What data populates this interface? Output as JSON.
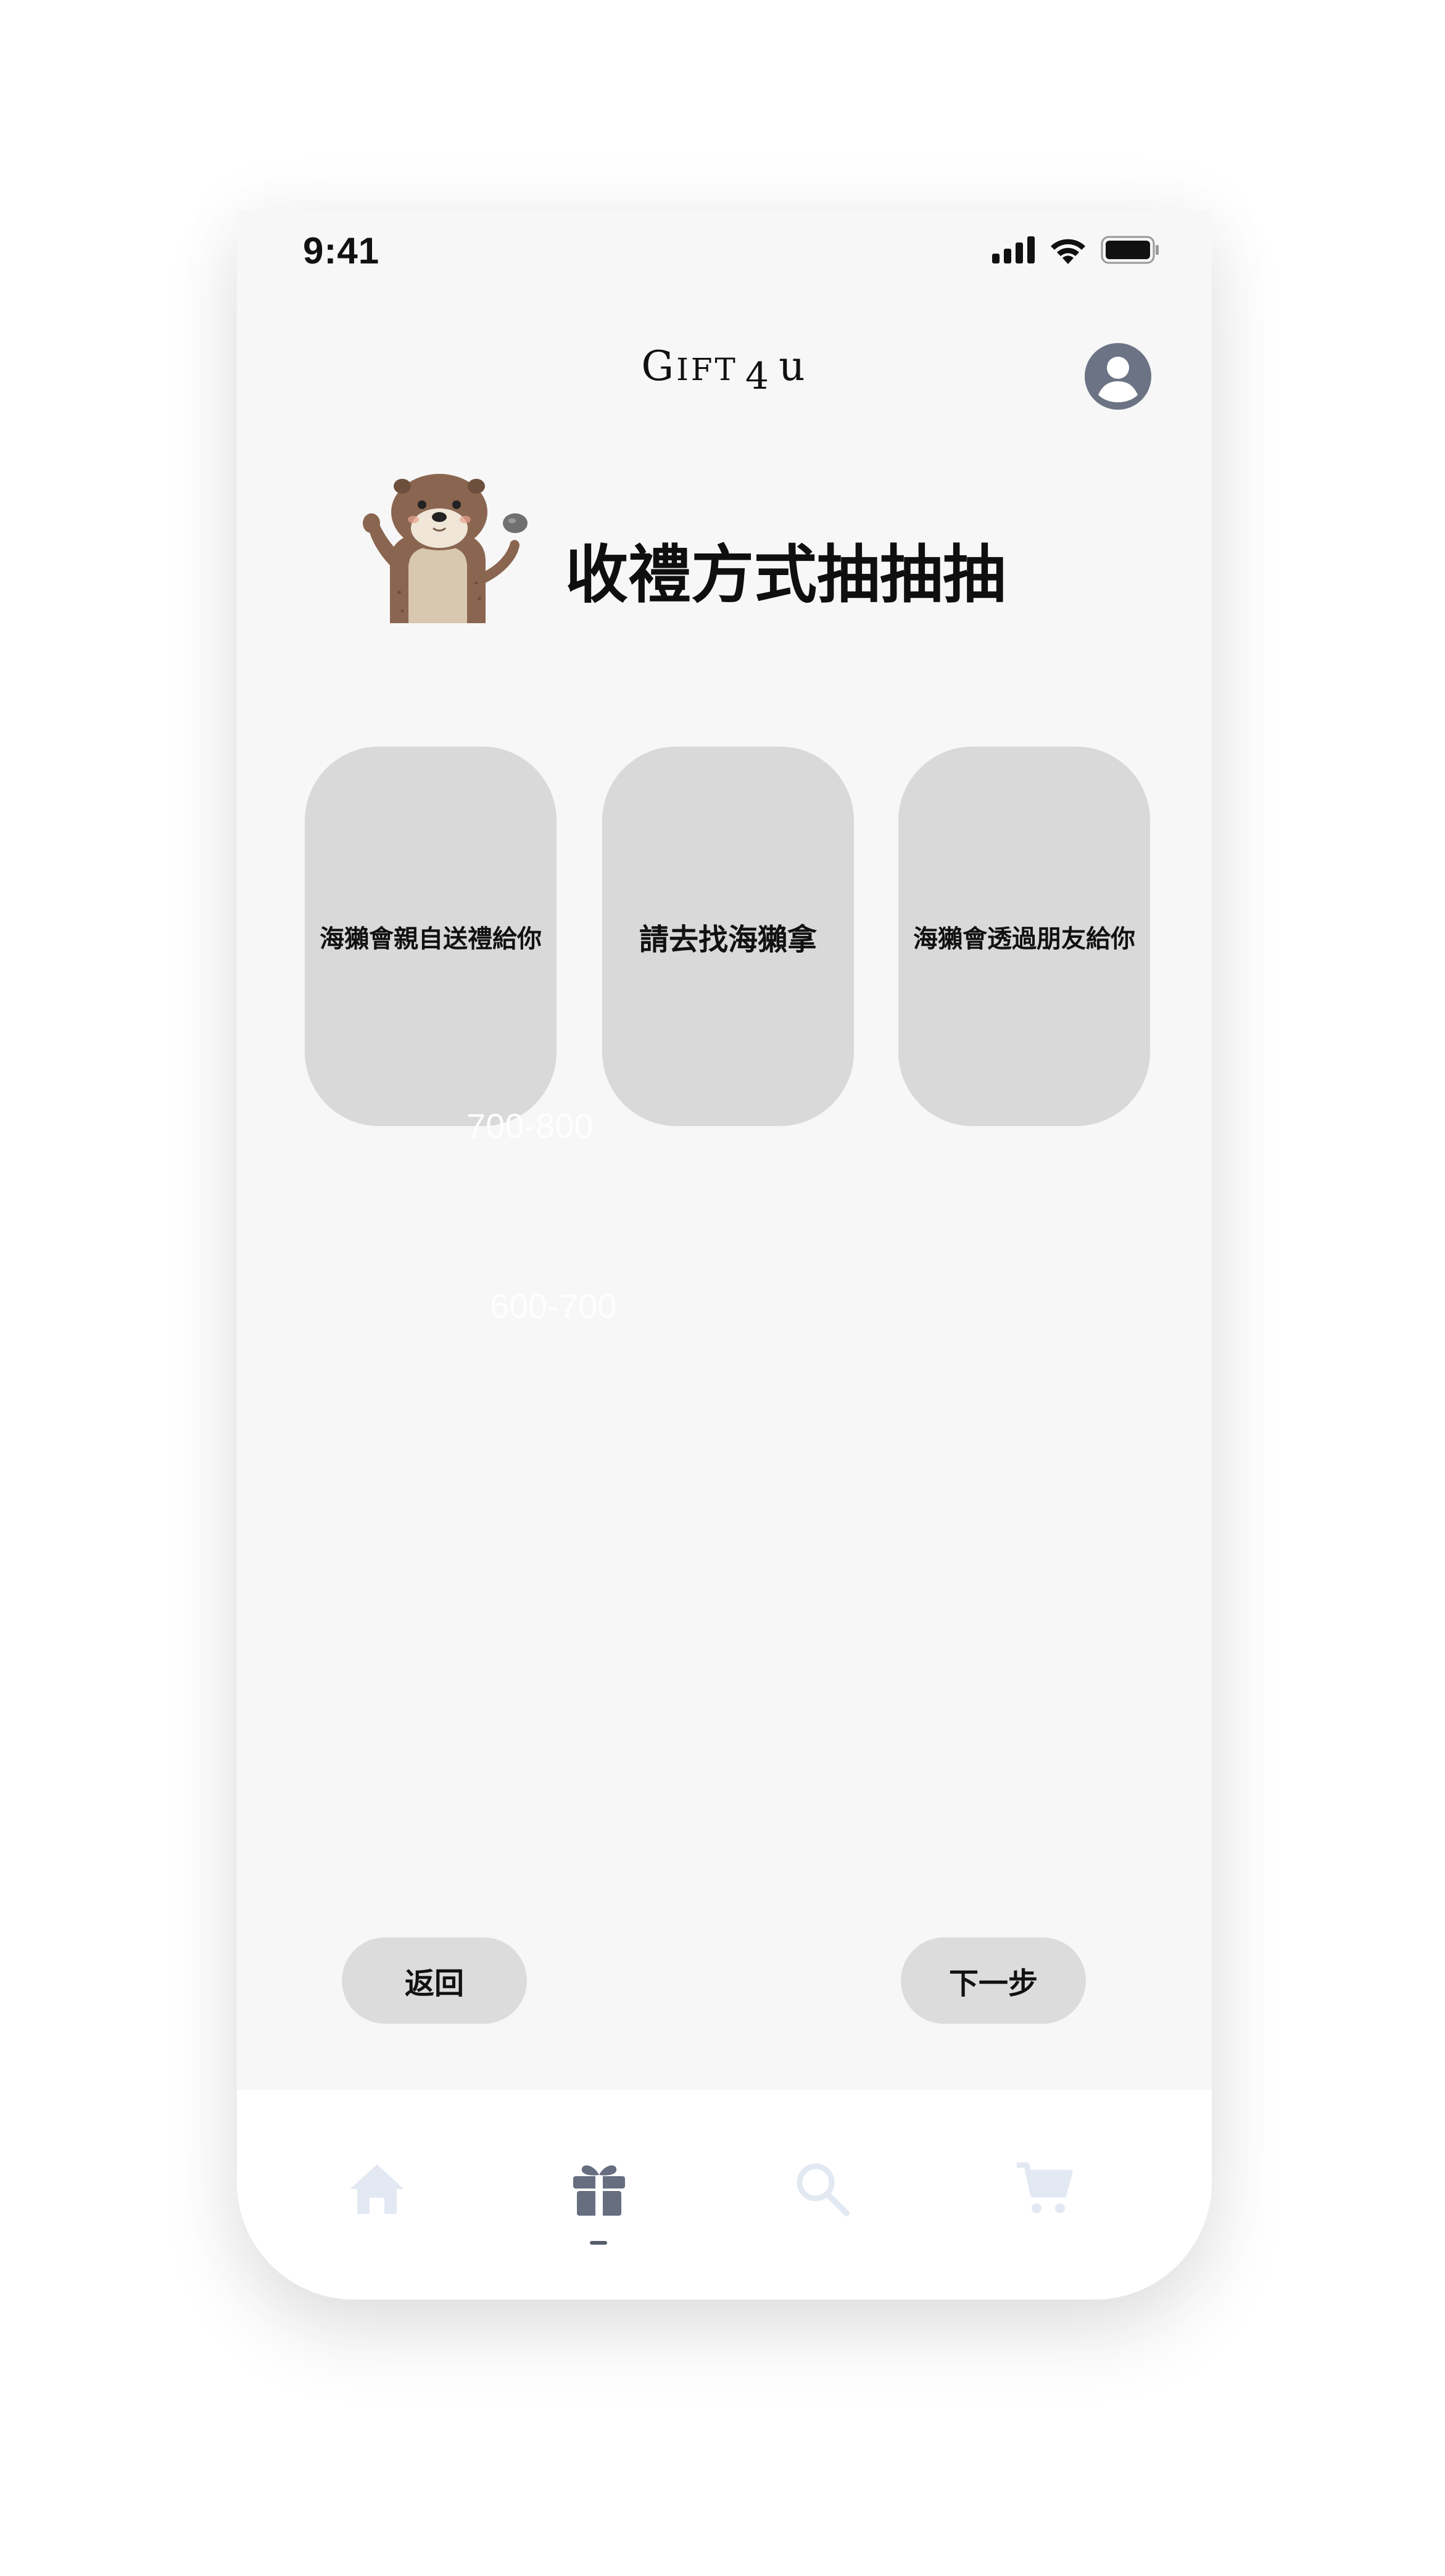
{
  "status_bar": {
    "time": "9:41"
  },
  "header": {
    "brand_g": "G",
    "brand_ift": "IFT",
    "brand_4": "4",
    "brand_u": "u",
    "avatar_icon": "user-circle-icon"
  },
  "hero": {
    "mascot_icon": "otter-mascot",
    "title": "收禮方式抽抽抽"
  },
  "cards": [
    {
      "label": "海獺會親自送禮給你"
    },
    {
      "label": "請去找海獺拿"
    },
    {
      "label": "海獺會透過朋友給你"
    }
  ],
  "ghost_text": {
    "first": "700-800",
    "second": "600-700"
  },
  "actions": {
    "back_label": "返回",
    "next_label": "下一步"
  },
  "tabbar": {
    "items": [
      {
        "icon": "home-icon",
        "active": false
      },
      {
        "icon": "gift-icon",
        "active": true
      },
      {
        "icon": "search-icon",
        "active": false
      },
      {
        "icon": "cart-icon",
        "active": false
      }
    ]
  },
  "colors": {
    "background": "#f7f7f7",
    "card": "#d9d9d9",
    "button": "#dcdcdc",
    "active_icon": "#666e80",
    "inactive_icon": "#e3e9f2"
  }
}
